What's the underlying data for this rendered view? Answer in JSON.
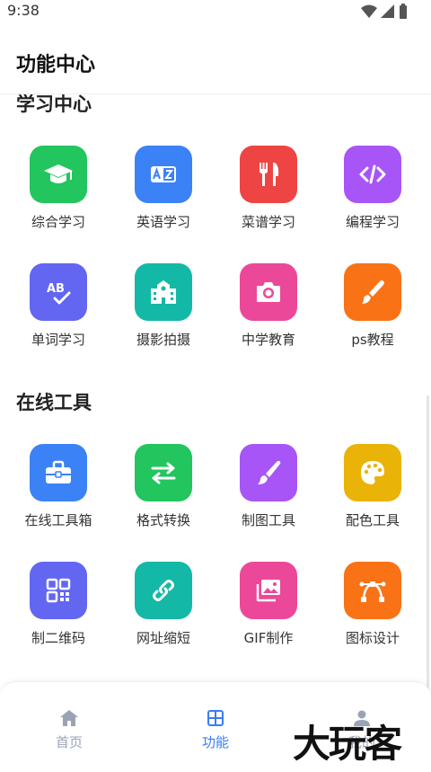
{
  "status_bar": {
    "time": "9:38"
  },
  "header": {
    "title": "功能中心"
  },
  "sections": [
    {
      "title": "学习中心",
      "items": [
        {
          "label": "综合学习",
          "icon": "graduation-cap-icon",
          "color": "#22c55e"
        },
        {
          "label": "英语学习",
          "icon": "translate-icon",
          "color": "#3b82f6"
        },
        {
          "label": "菜谱学习",
          "icon": "utensils-icon",
          "color": "#ef4444"
        },
        {
          "label": "编程学习",
          "icon": "code-icon",
          "color": "#a855f7"
        },
        {
          "label": "单词学习",
          "icon": "spell-check-icon",
          "color": "#6366f1"
        },
        {
          "label": "摄影拍摄",
          "icon": "school-building-icon",
          "color": "#14b8a6"
        },
        {
          "label": "中学教育",
          "icon": "camera-icon",
          "color": "#ec4899"
        },
        {
          "label": "ps教程",
          "icon": "paint-brush-icon",
          "color": "#f97316"
        }
      ]
    },
    {
      "title": "在线工具",
      "items": [
        {
          "label": "在线工具箱",
          "icon": "toolbox-icon",
          "color": "#3b82f6"
        },
        {
          "label": "格式转换",
          "icon": "exchange-arrows-icon",
          "color": "#22c55e"
        },
        {
          "label": "制图工具",
          "icon": "brush-icon",
          "color": "#a855f7"
        },
        {
          "label": "配色工具",
          "icon": "palette-icon",
          "color": "#eab308"
        },
        {
          "label": "制二维码",
          "icon": "qr-code-icon",
          "color": "#6366f1"
        },
        {
          "label": "网址缩短",
          "icon": "link-icon",
          "color": "#14b8a6"
        },
        {
          "label": "GIF制作",
          "icon": "images-icon",
          "color": "#ec4899"
        },
        {
          "label": "图标设计",
          "icon": "vector-pen-icon",
          "color": "#f97316"
        }
      ]
    }
  ],
  "bottom_nav": [
    {
      "label": "首页",
      "icon": "home-icon",
      "active": false
    },
    {
      "label": "功能",
      "icon": "grid-icon",
      "active": true
    },
    {
      "label": "我的",
      "icon": "user-icon",
      "active": false
    }
  ],
  "watermark": "大玩客",
  "colors": {
    "accent": "#3b7cf5",
    "nav_inactive": "#9aa3b5"
  }
}
